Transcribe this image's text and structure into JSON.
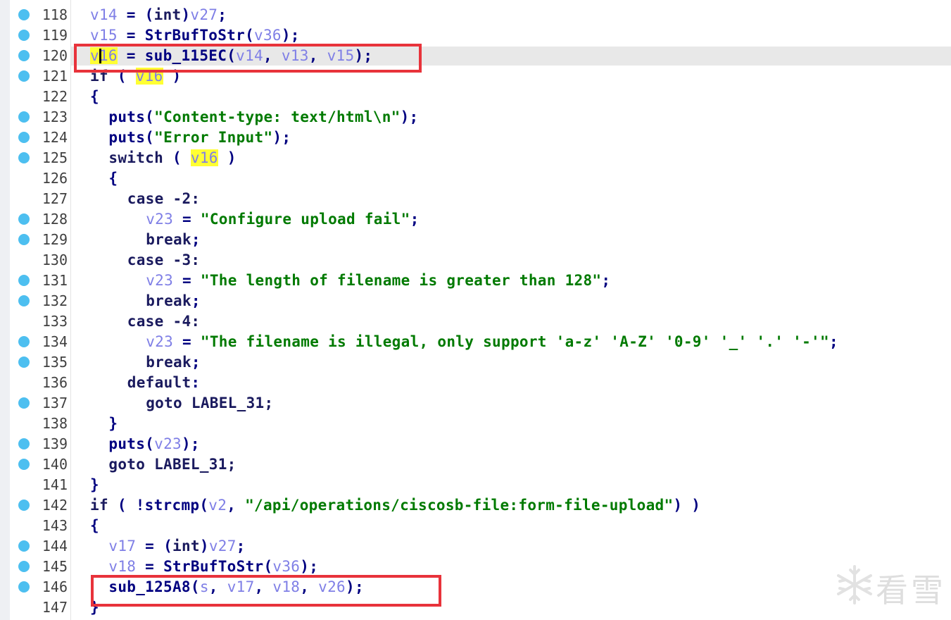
{
  "editor": {
    "current_line": 120,
    "lines": [
      {
        "num": "118",
        "bp": true,
        "indent": 1,
        "tokens": [
          [
            "v14",
            "var"
          ],
          [
            " = (",
            "punct"
          ],
          [
            "int",
            "kw"
          ],
          [
            ")",
            "punct"
          ],
          [
            "v27",
            "var"
          ],
          [
            ";",
            "punct"
          ]
        ]
      },
      {
        "num": "119",
        "bp": true,
        "indent": 1,
        "tokens": [
          [
            "v15",
            "var"
          ],
          [
            " = ",
            "punct"
          ],
          [
            "StrBufToStr",
            "func"
          ],
          [
            "(",
            "punct"
          ],
          [
            "v36",
            "var"
          ],
          [
            ");",
            "punct"
          ]
        ]
      },
      {
        "num": "120",
        "bp": true,
        "indent": 1,
        "tokens": [
          [
            "v16",
            "var-hl"
          ],
          [
            " = ",
            "punct"
          ],
          [
            "sub_115EC",
            "func"
          ],
          [
            "(",
            "punct"
          ],
          [
            "v14",
            "var"
          ],
          [
            ", ",
            "punct"
          ],
          [
            "v13",
            "var"
          ],
          [
            ", ",
            "punct"
          ],
          [
            "v15",
            "var"
          ],
          [
            ");",
            "punct"
          ]
        ]
      },
      {
        "num": "121",
        "bp": true,
        "indent": 1,
        "tokens": [
          [
            "if",
            "kw"
          ],
          [
            " ( ",
            "punct"
          ],
          [
            "v16",
            "var-hl"
          ],
          [
            " )",
            "punct"
          ]
        ]
      },
      {
        "num": "122",
        "bp": false,
        "indent": 1,
        "tokens": [
          [
            "{",
            "punct"
          ]
        ]
      },
      {
        "num": "123",
        "bp": true,
        "indent": 2,
        "tokens": [
          [
            "puts",
            "func"
          ],
          [
            "(",
            "punct"
          ],
          [
            "\"Content-type: text/html\\n\"",
            "str"
          ],
          [
            ");",
            "punct"
          ]
        ]
      },
      {
        "num": "124",
        "bp": true,
        "indent": 2,
        "tokens": [
          [
            "puts",
            "func"
          ],
          [
            "(",
            "punct"
          ],
          [
            "\"Error Input\"",
            "str"
          ],
          [
            ");",
            "punct"
          ]
        ]
      },
      {
        "num": "125",
        "bp": true,
        "indent": 2,
        "tokens": [
          [
            "switch",
            "kw"
          ],
          [
            " ( ",
            "punct"
          ],
          [
            "v16",
            "var-hl"
          ],
          [
            " )",
            "punct"
          ]
        ]
      },
      {
        "num": "126",
        "bp": false,
        "indent": 2,
        "tokens": [
          [
            "{",
            "punct"
          ]
        ]
      },
      {
        "num": "127",
        "bp": false,
        "indent": 3,
        "tokens": [
          [
            "case",
            "kw"
          ],
          [
            " -2:",
            "num"
          ]
        ]
      },
      {
        "num": "128",
        "bp": true,
        "indent": 4,
        "tokens": [
          [
            "v23",
            "var"
          ],
          [
            " = ",
            "punct"
          ],
          [
            "\"Configure upload fail\"",
            "str"
          ],
          [
            ";",
            "punct"
          ]
        ]
      },
      {
        "num": "129",
        "bp": true,
        "indent": 4,
        "tokens": [
          [
            "break",
            "kw"
          ],
          [
            ";",
            "punct"
          ]
        ]
      },
      {
        "num": "130",
        "bp": false,
        "indent": 3,
        "tokens": [
          [
            "case",
            "kw"
          ],
          [
            " -3:",
            "num"
          ]
        ]
      },
      {
        "num": "131",
        "bp": true,
        "indent": 4,
        "tokens": [
          [
            "v23",
            "var"
          ],
          [
            " = ",
            "punct"
          ],
          [
            "\"The length of filename is greater than 128\"",
            "str"
          ],
          [
            ";",
            "punct"
          ]
        ]
      },
      {
        "num": "132",
        "bp": true,
        "indent": 4,
        "tokens": [
          [
            "break",
            "kw"
          ],
          [
            ";",
            "punct"
          ]
        ]
      },
      {
        "num": "133",
        "bp": false,
        "indent": 3,
        "tokens": [
          [
            "case",
            "kw"
          ],
          [
            " -4:",
            "num"
          ]
        ]
      },
      {
        "num": "134",
        "bp": true,
        "indent": 4,
        "tokens": [
          [
            "v23",
            "var"
          ],
          [
            " = ",
            "punct"
          ],
          [
            "\"The filename is illegal, only support 'a-z' 'A-Z' '0-9' '_' '.' '-'\"",
            "str"
          ],
          [
            ";",
            "punct"
          ]
        ]
      },
      {
        "num": "135",
        "bp": true,
        "indent": 4,
        "tokens": [
          [
            "break",
            "kw"
          ],
          [
            ";",
            "punct"
          ]
        ]
      },
      {
        "num": "136",
        "bp": false,
        "indent": 3,
        "tokens": [
          [
            "default",
            "kw"
          ],
          [
            ":",
            "punct"
          ]
        ]
      },
      {
        "num": "137",
        "bp": true,
        "indent": 4,
        "tokens": [
          [
            "goto",
            "kw"
          ],
          [
            " LABEL_31;",
            "kw"
          ]
        ]
      },
      {
        "num": "138",
        "bp": false,
        "indent": 2,
        "tokens": [
          [
            "}",
            "punct"
          ]
        ]
      },
      {
        "num": "139",
        "bp": true,
        "indent": 2,
        "tokens": [
          [
            "puts",
            "func"
          ],
          [
            "(",
            "punct"
          ],
          [
            "v23",
            "var"
          ],
          [
            ");",
            "punct"
          ]
        ]
      },
      {
        "num": "140",
        "bp": true,
        "indent": 2,
        "tokens": [
          [
            "goto",
            "kw"
          ],
          [
            " LABEL_31;",
            "kw"
          ]
        ]
      },
      {
        "num": "141",
        "bp": false,
        "indent": 1,
        "tokens": [
          [
            "}",
            "punct"
          ]
        ]
      },
      {
        "num": "142",
        "bp": true,
        "indent": 1,
        "tokens": [
          [
            "if",
            "kw"
          ],
          [
            " ( !",
            "punct"
          ],
          [
            "strcmp",
            "func"
          ],
          [
            "(",
            "punct"
          ],
          [
            "v2",
            "var"
          ],
          [
            ", ",
            "punct"
          ],
          [
            "\"/api/operations/ciscosb-file:form-file-upload\"",
            "str"
          ],
          [
            ") )",
            "punct"
          ]
        ]
      },
      {
        "num": "143",
        "bp": false,
        "indent": 1,
        "tokens": [
          [
            "{",
            "punct"
          ]
        ]
      },
      {
        "num": "144",
        "bp": true,
        "indent": 2,
        "tokens": [
          [
            "v17",
            "var"
          ],
          [
            " = (",
            "punct"
          ],
          [
            "int",
            "kw"
          ],
          [
            ")",
            "punct"
          ],
          [
            "v27",
            "var"
          ],
          [
            ";",
            "punct"
          ]
        ]
      },
      {
        "num": "145",
        "bp": true,
        "indent": 2,
        "tokens": [
          [
            "v18",
            "var"
          ],
          [
            " = ",
            "punct"
          ],
          [
            "StrBufToStr",
            "func"
          ],
          [
            "(",
            "punct"
          ],
          [
            "v36",
            "var"
          ],
          [
            ");",
            "punct"
          ]
        ]
      },
      {
        "num": "146",
        "bp": true,
        "indent": 2,
        "tokens": [
          [
            "sub_125A8",
            "func"
          ],
          [
            "(",
            "punct"
          ],
          [
            "s",
            "var"
          ],
          [
            ", ",
            "punct"
          ],
          [
            "v17",
            "var"
          ],
          [
            ", ",
            "punct"
          ],
          [
            "v18",
            "var"
          ],
          [
            ", ",
            "punct"
          ],
          [
            "v26",
            "var"
          ],
          [
            ");",
            "punct"
          ]
        ]
      },
      {
        "num": "147",
        "bp": false,
        "indent": 1,
        "tokens": [
          [
            "}",
            "punct"
          ]
        ]
      }
    ]
  },
  "annotations": [
    {
      "label": "call-sub-115EC",
      "line": "120"
    },
    {
      "label": "call-sub-125A8",
      "line": "146"
    }
  ],
  "watermark": {
    "text": "看雪",
    "icon": "snowflake-logo"
  },
  "colors": {
    "variable": "#7f7fe6",
    "function": "#000080",
    "string": "#007a00",
    "highlight": "#ffff33",
    "annotation_box": "#e8333b",
    "breakpoint": "#4dbff0"
  }
}
